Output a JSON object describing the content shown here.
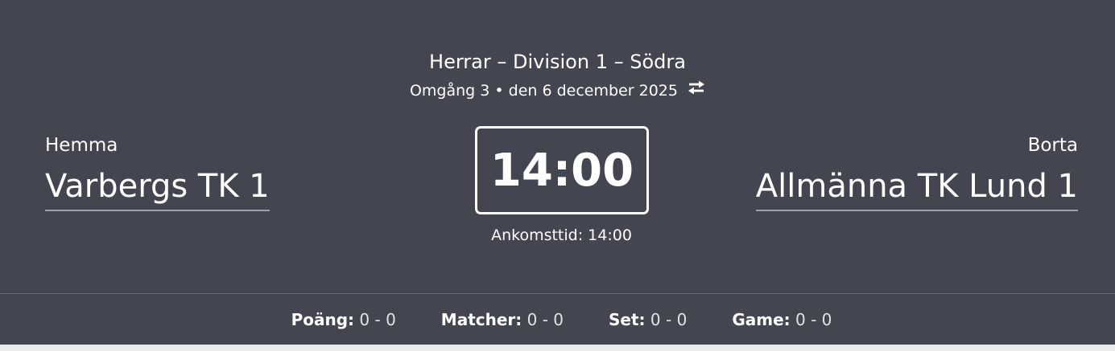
{
  "match": {
    "league": "Herrar – Division 1 – Södra",
    "round_date": "Omgång 3 • den 6 december 2025",
    "swap_icon": "swap-arrows-icon",
    "home": {
      "label": "Hemma",
      "team": "Varbergs TK 1"
    },
    "away": {
      "label": "Borta",
      "team": "Allmänna TK Lund 1"
    },
    "start_time": "14:00",
    "arrival": "Ankomsttid: 14:00"
  },
  "stats": [
    {
      "label": "Poäng:",
      "value": "0 - 0"
    },
    {
      "label": "Matcher:",
      "value": "0 - 0"
    },
    {
      "label": "Set:",
      "value": "0 - 0"
    },
    {
      "label": "Game:",
      "value": "0 - 0"
    }
  ],
  "colors": {
    "panel": "#434551",
    "text": "#ffffff",
    "divider": "#6a6c78",
    "underline": "#9ea0aa",
    "page": "#f2f2f2"
  }
}
